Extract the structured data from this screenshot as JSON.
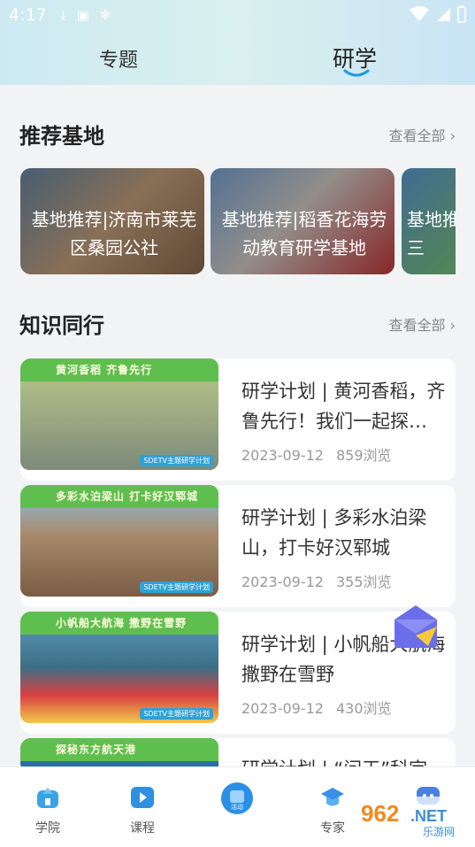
{
  "status": {
    "time": "4:17"
  },
  "top_tabs": [
    {
      "label": "专题"
    },
    {
      "label": "研学"
    }
  ],
  "recommended": {
    "title": "推荐基地",
    "see_all": "查看全部",
    "cards": [
      {
        "text": "基地推荐|济南市莱芜区桑园公社"
      },
      {
        "text": "基地推荐|稻香花海劳动教育研学基地"
      },
      {
        "text": "基地推口三"
      }
    ]
  },
  "knowledge": {
    "title": "知识同行",
    "see_all": "查看全部",
    "articles": [
      {
        "banner": "黄河香稻  齐鲁先行",
        "brand": "SDETV主题研学计划",
        "title": "研学计划 | 黄河香稻，齐鲁先行！我们一起探…",
        "date": "2023-09-12",
        "views": "859浏览"
      },
      {
        "banner": "多彩水泊梁山  打卡好汉郓城",
        "brand": "SDETV主题研学计划",
        "title": "研学计划 | 多彩水泊梁山，打卡好汉郓城",
        "date": "2023-09-12",
        "views": "355浏览"
      },
      {
        "banner": "小帆船大航海  撒野在雪野",
        "brand": "SDETV主题研学计划",
        "title": "研学计划 | 小帆船大航海撒野在雪野",
        "date": "2023-09-12",
        "views": "430浏览"
      },
      {
        "banner": "探秘东方航天港",
        "brand": "",
        "title": "研学计划 | “问天”科宇",
        "date": "",
        "views": ""
      }
    ]
  },
  "bottom_nav": [
    {
      "label": "学院"
    },
    {
      "label": "课程"
    },
    {
      "label": "活动"
    },
    {
      "label": "专家"
    },
    {
      "label": ""
    }
  ],
  "watermark": {
    "text": "962.NET",
    "sub": "乐游网"
  }
}
